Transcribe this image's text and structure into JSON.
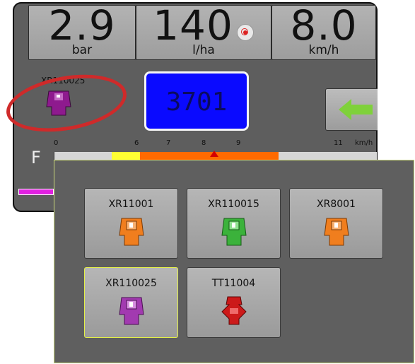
{
  "readouts": {
    "pressure": {
      "value": "2.9",
      "unit": "bar"
    },
    "rate": {
      "value": "140",
      "unit": "l/ha",
      "icon": "target-icon"
    },
    "speed": {
      "value": "8.0",
      "unit": "km/h"
    }
  },
  "current_nozzle": {
    "label": "XR110025",
    "color": "#8e1a8e"
  },
  "counter": {
    "value": "3701",
    "color": "#0a0aff"
  },
  "back_button": {
    "icon": "green-arrow-left-icon",
    "color": "#7fd13b"
  },
  "speed_bar": {
    "label": "F",
    "ticks": [
      "0",
      "6",
      "7",
      "8",
      "9",
      "11",
      "km/h"
    ],
    "marker_value": 8
  },
  "nozzle_panel": {
    "nozzles": [
      {
        "label": "XR11001",
        "color": "#f07e1e",
        "selected": false
      },
      {
        "label": "XR110015",
        "color": "#3bb23b",
        "selected": false
      },
      {
        "label": "XR8001",
        "color": "#f07e1e",
        "selected": false
      },
      {
        "label": "XR110025",
        "color": "#a23ab0",
        "selected": true
      },
      {
        "label": "TT11004",
        "color": "#cc1a1a",
        "selected": false
      }
    ]
  }
}
